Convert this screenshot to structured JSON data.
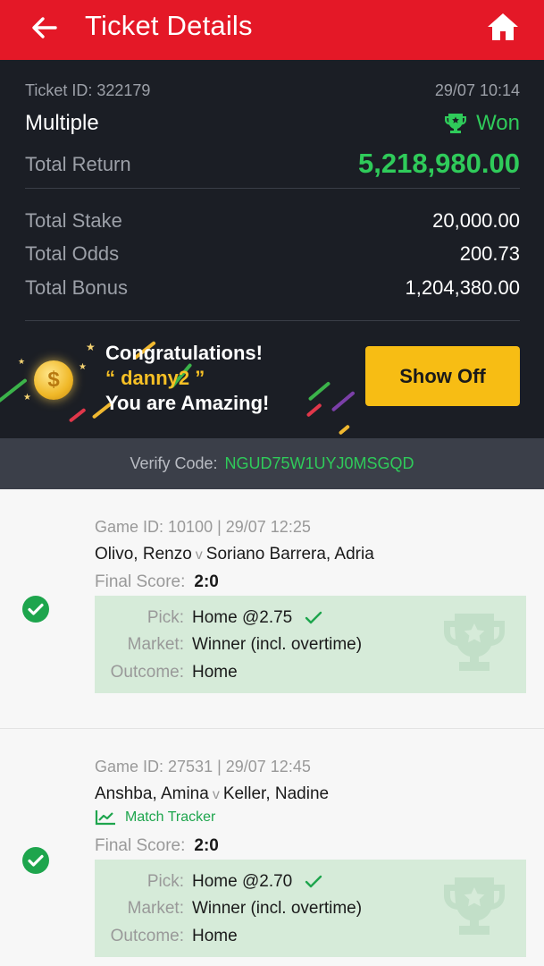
{
  "header": {
    "title": "Ticket Details",
    "back_icon": "back-arrow-icon",
    "home_icon": "home-icon"
  },
  "ticket": {
    "id_text": "Ticket ID: 322179",
    "datetime": "29/07 10:14",
    "type": "Multiple",
    "status": "Won",
    "total_return_label": "Total Return",
    "total_return": "5,218,980.00",
    "stake_label": "Total Stake",
    "stake": "20,000.00",
    "odds_label": "Total Odds",
    "odds": "200.73",
    "bonus_label": "Total Bonus",
    "bonus": "1,204,380.00"
  },
  "congrats": {
    "line1": "Congratulations!",
    "line2": "“ danny2 ”",
    "line3": "You are Amazing!",
    "button": "Show Off"
  },
  "verify": {
    "label": "Verify Code:",
    "code": "NGUD75W1UYJ0MSGQD"
  },
  "games": [
    {
      "header": "Game ID: 10100 | 29/07 12:25",
      "home": "Olivo, Renzo",
      "vs": "v",
      "away": "Soriano Barrera, Adria",
      "tracker": "",
      "final_score_label": "Final Score:",
      "final_score": "2:0",
      "pick_label": "Pick:",
      "pick": "Home @2.75",
      "market_label": "Market:",
      "market": "Winner (incl. overtime)",
      "outcome_label": "Outcome:",
      "outcome": "Home"
    },
    {
      "header": "Game ID: 27531 | 29/07 12:45",
      "home": "Anshba, Amina",
      "vs": "v",
      "away": "Keller, Nadine",
      "tracker": "Match Tracker",
      "final_score_label": "Final Score:",
      "final_score": "2:0",
      "pick_label": "Pick:",
      "pick": "Home @2.70",
      "market_label": "Market:",
      "market": "Winner (incl. overtime)",
      "outcome_label": "Outcome:",
      "outcome": "Home"
    }
  ],
  "colors": {
    "brand_red": "#e41827",
    "won_green": "#2fcb5a",
    "button_yellow": "#f7bd14",
    "dark_bg": "#1b1e25"
  }
}
